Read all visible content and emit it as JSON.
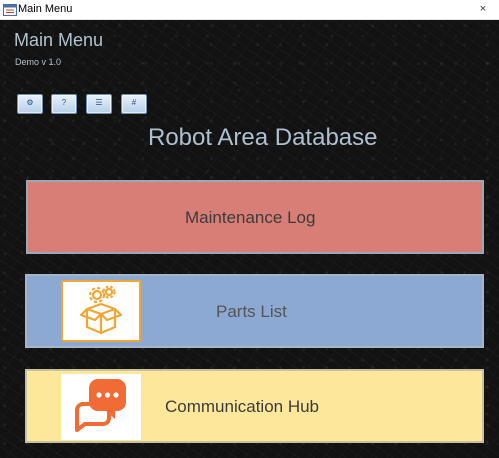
{
  "window": {
    "title": "Main Menu",
    "close_glyph": "×"
  },
  "header": {
    "title": "Main Menu",
    "version": "Demo v 1.0"
  },
  "toolbar": {
    "buttons": [
      {
        "icon": "settings-icon",
        "glyph": "⚙"
      },
      {
        "icon": "help-icon",
        "glyph": "?"
      },
      {
        "icon": "list-icon",
        "glyph": "☰"
      },
      {
        "icon": "grid-icon",
        "glyph": "#"
      }
    ]
  },
  "main": {
    "title": "Robot Area Database",
    "buttons": {
      "maintenance": {
        "label": "Maintenance Log"
      },
      "parts": {
        "label": "Parts List",
        "icon": "parts-box-icon"
      },
      "communication": {
        "label": "Communication Hub",
        "icon": "chat-icon"
      }
    }
  },
  "colors": {
    "maintenance_bg": "#d97e77",
    "parts_bg": "#8ba9d2",
    "communication_bg": "#fde79a",
    "accent_orange": "#f2a632",
    "chat_orange": "#f26b35"
  }
}
